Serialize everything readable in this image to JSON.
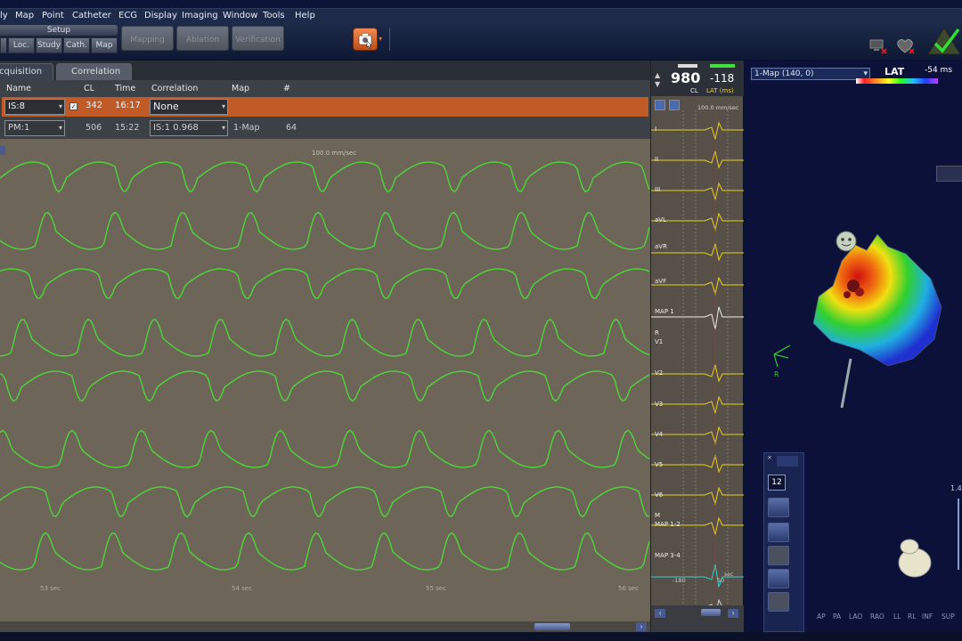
{
  "menu": [
    "ly",
    "Map",
    "Point",
    "Catheter",
    "ECG",
    "Display",
    "Imaging",
    "Window",
    "Tools",
    "Help"
  ],
  "toolbar": {
    "setup_label": "Setup",
    "setup_buttons": [
      "Loc.",
      "Study",
      "Cath.",
      "Map"
    ],
    "mode_buttons": [
      "Mapping",
      "Ablation",
      "Verification"
    ]
  },
  "tabs": [
    "cquisition",
    "Correlation"
  ],
  "table": {
    "headers": [
      "Name",
      "CL",
      "Time",
      "Correlation",
      "Map",
      "#"
    ],
    "row1": {
      "name": "IS:8",
      "cl": "342",
      "time": "16:17",
      "correlation": "None"
    },
    "row2": {
      "name": "PM:1",
      "cl": "506",
      "time": "15:22",
      "correlation": "IS:1  0.968",
      "map": "1-Map",
      "count": "64"
    }
  },
  "waveform": {
    "speed": "100.0 mm/sec",
    "time_labels": [
      "53 sec",
      "54 sec",
      "55 sec",
      "56 sec"
    ]
  },
  "ecg": {
    "cl": "980",
    "cl_label": "CL",
    "lat": "-118",
    "lat_label": "LAT (ms)",
    "speed": "100.0 mm/sec",
    "leads": [
      "I",
      "II",
      "III",
      "aVL",
      "aVR",
      "aVF",
      "MAP 1",
      "R",
      "V1",
      "V2",
      "V3",
      "V4",
      "V5",
      "V6",
      "M",
      "MAP 1-2",
      "MAP 3-4"
    ],
    "axis_left": "-180",
    "axis_right": "50",
    "axis_unit": "sec"
  },
  "map": {
    "selector": "1-Map (140, 0)",
    "title": "LAT",
    "lat_ms": "-54 ms",
    "tool_count": "12",
    "axis_r": "R",
    "zoom": "1.4",
    "views": [
      "AP",
      "PA",
      "LAO",
      "RAO",
      "LL",
      "RL",
      "INF",
      "SUP"
    ]
  },
  "colors": {
    "wave": "#4cd836",
    "ecg_yellow": "#e8d020",
    "map_cyan": "#30d0d0",
    "row_selected": "#c05a26"
  }
}
